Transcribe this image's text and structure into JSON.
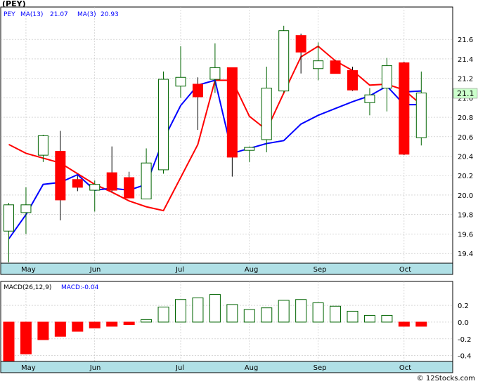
{
  "header": {
    "ticker": "(PEY)",
    "symbol": "PEY",
    "ma13_label": "MA(13)",
    "ma13_value": "21.07",
    "ma3_label": "MA(3)",
    "ma3_value": "20.93"
  },
  "macd_header": {
    "label": "MACD(26,12,9)",
    "value_label": "MACD:-0.04"
  },
  "last_price_tag": "21.1",
  "copyright": "© 12Stocks.com",
  "colors": {
    "up_candle": "#ffffff",
    "up_border": "#006400",
    "down_candle": "#ff0000",
    "ma13": "#0000ff",
    "ma3": "#ff0000",
    "month_band": "#b0e0e6",
    "price_tag": "#ccffcc",
    "grid": "#c0c0c0"
  },
  "chart_data": [
    {
      "type": "candlestick",
      "title": "(PEY)",
      "y_ticks": [
        19.4,
        19.6,
        19.8,
        20.0,
        20.2,
        20.4,
        20.6,
        20.8,
        21.0,
        21.2,
        21.4,
        21.6
      ],
      "ylim": [
        19.3,
        21.76
      ],
      "x_labels": [
        {
          "label": "May",
          "index": 1
        },
        {
          "label": "Jun",
          "index": 5
        },
        {
          "label": "Jul",
          "index": 10
        },
        {
          "label": "Aug",
          "index": 14
        },
        {
          "label": "Sep",
          "index": 18
        },
        {
          "label": "Oct",
          "index": 23
        }
      ],
      "grid": true,
      "candles": [
        {
          "o": 19.63,
          "h": 19.92,
          "l": 19.31,
          "c": 19.9
        },
        {
          "o": 19.82,
          "h": 20.08,
          "l": 19.6,
          "c": 19.9
        },
        {
          "o": 20.41,
          "h": 20.62,
          "l": 20.34,
          "c": 20.61
        },
        {
          "o": 20.45,
          "h": 20.66,
          "l": 19.74,
          "c": 19.95
        },
        {
          "o": 20.16,
          "h": 20.2,
          "l": 20.04,
          "c": 20.08
        },
        {
          "o": 20.05,
          "h": 20.15,
          "l": 19.83,
          "c": 20.11
        },
        {
          "o": 20.23,
          "h": 20.5,
          "l": 20.03,
          "c": 20.05
        },
        {
          "o": 20.18,
          "h": 20.24,
          "l": 19.97,
          "c": 19.97
        },
        {
          "o": 19.96,
          "h": 20.48,
          "l": 19.96,
          "c": 20.33
        },
        {
          "o": 20.26,
          "h": 21.27,
          "l": 20.22,
          "c": 21.19
        },
        {
          "o": 21.12,
          "h": 21.53,
          "l": 21.0,
          "c": 21.21
        },
        {
          "o": 21.14,
          "h": 21.21,
          "l": 20.67,
          "c": 21.01
        },
        {
          "o": 21.19,
          "h": 21.56,
          "l": 21.05,
          "c": 21.31
        },
        {
          "o": 21.31,
          "h": 21.31,
          "l": 20.19,
          "c": 20.39
        },
        {
          "o": 20.46,
          "h": 20.5,
          "l": 20.34,
          "c": 20.49
        },
        {
          "o": 20.57,
          "h": 21.32,
          "l": 20.44,
          "c": 21.1
        },
        {
          "o": 21.07,
          "h": 21.74,
          "l": 21.05,
          "c": 21.69
        },
        {
          "o": 21.64,
          "h": 21.66,
          "l": 21.25,
          "c": 21.47
        },
        {
          "o": 21.3,
          "h": 21.57,
          "l": 21.18,
          "c": 21.38
        },
        {
          "o": 21.38,
          "h": 21.39,
          "l": 21.25,
          "c": 21.25
        },
        {
          "o": 21.28,
          "h": 21.32,
          "l": 21.07,
          "c": 21.08
        },
        {
          "o": 20.95,
          "h": 21.1,
          "l": 20.82,
          "c": 21.03
        },
        {
          "o": 21.1,
          "h": 21.41,
          "l": 20.86,
          "c": 21.33
        },
        {
          "o": 21.36,
          "h": 21.37,
          "l": 20.41,
          "c": 20.42
        },
        {
          "o": 20.59,
          "h": 21.27,
          "l": 20.51,
          "c": 21.05
        }
      ],
      "series": [
        {
          "name": "MA(3)",
          "color": "#ff0000",
          "points": [
            [
              0,
              20.52
            ],
            [
              1,
              20.43
            ],
            [
              2,
              20.38
            ],
            [
              3,
              20.33
            ],
            [
              4,
              20.22
            ],
            [
              5,
              20.11
            ],
            [
              6,
              20.03
            ],
            [
              7,
              19.94
            ],
            [
              8,
              19.88
            ],
            [
              9,
              19.84
            ],
            [
              10,
              20.18
            ],
            [
              11,
              20.52
            ],
            [
              12,
              21.18
            ],
            [
              13,
              21.18
            ],
            [
              14,
              20.81
            ],
            [
              15,
              20.67
            ],
            [
              16,
              21.05
            ],
            [
              17,
              21.42
            ],
            [
              18,
              21.53
            ],
            [
              19,
              21.38
            ],
            [
              20,
              21.28
            ],
            [
              21,
              21.13
            ],
            [
              22,
              21.14
            ],
            [
              23,
              21.08
            ],
            [
              24,
              20.93
            ]
          ]
        },
        {
          "name": "MA(13)",
          "color": "#0000ff",
          "points": [
            [
              0,
              19.55
            ],
            [
              1,
              19.8
            ],
            [
              2,
              20.11
            ],
            [
              3,
              20.13
            ],
            [
              4,
              20.21
            ],
            [
              5,
              20.05
            ],
            [
              6,
              20.07
            ],
            [
              7,
              20.05
            ],
            [
              8,
              20.11
            ],
            [
              9,
              20.57
            ],
            [
              10,
              20.92
            ],
            [
              11,
              21.13
            ],
            [
              12,
              21.18
            ],
            [
              13,
              20.43
            ],
            [
              14,
              20.48
            ],
            [
              15,
              20.53
            ],
            [
              16,
              20.56
            ],
            [
              17,
              20.73
            ],
            [
              18,
              20.82
            ],
            [
              19,
              20.89
            ],
            [
              20,
              20.96
            ],
            [
              21,
              21.02
            ],
            [
              22,
              21.12
            ],
            [
              23,
              20.93
            ],
            [
              24,
              20.93
            ]
          ]
        }
      ],
      "ma13_extra_segment": [
        [
          23,
          21.06
        ],
        [
          24,
          21.07
        ]
      ],
      "last_price": 21.1
    },
    {
      "type": "bar",
      "title": "MACD(26,12,9)",
      "y_ticks": [
        -0.4,
        -0.2,
        0.0,
        0.2
      ],
      "ylim": [
        -0.47,
        0.36
      ],
      "grid": true,
      "values": [
        -0.48,
        -0.38,
        -0.21,
        -0.17,
        -0.11,
        -0.07,
        -0.05,
        -0.03,
        0.03,
        0.18,
        0.27,
        0.29,
        0.33,
        0.21,
        0.15,
        0.17,
        0.26,
        0.27,
        0.23,
        0.19,
        0.13,
        0.08,
        0.08,
        -0.05,
        -0.05
      ]
    }
  ]
}
